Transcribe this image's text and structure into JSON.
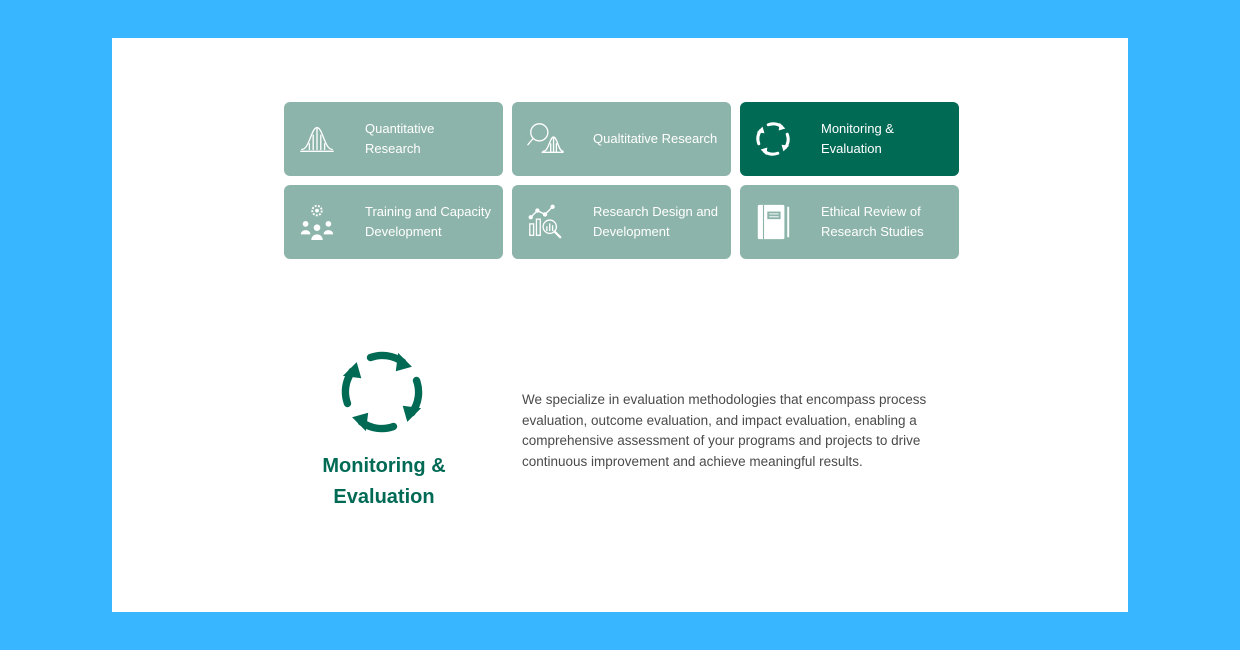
{
  "services": [
    {
      "label": "Quantitative Research",
      "icon": "bell-curve-icon",
      "active": false
    },
    {
      "label": "Qualtitative Research",
      "icon": "magnifier-curve-icon",
      "active": false
    },
    {
      "label": "Monitoring & Evaluation",
      "icon": "cycle-arrows-icon",
      "active": true
    },
    {
      "label": "Training and Capacity Development",
      "icon": "team-gear-icon",
      "active": false
    },
    {
      "label": "Research Design and Development",
      "icon": "analytics-magnifier-icon",
      "active": false
    },
    {
      "label": "Ethical Review of Research Studies",
      "icon": "notebook-icon",
      "active": false
    }
  ],
  "detail": {
    "title": "Monitoring & Evaluation",
    "description": "We specialize in evaluation methodologies that encompass process evaluation, outcome evaluation, and impact evaluation, enabling a comprehensive assessment of your programs and projects to drive continuous improvement and achieve meaningful results.",
    "icon": "cycle-arrows-icon"
  },
  "colors": {
    "background": "#38b6ff",
    "panel": "#ffffff",
    "card": "#8db4aa",
    "card_active": "#016a55",
    "accent": "#016a55"
  }
}
